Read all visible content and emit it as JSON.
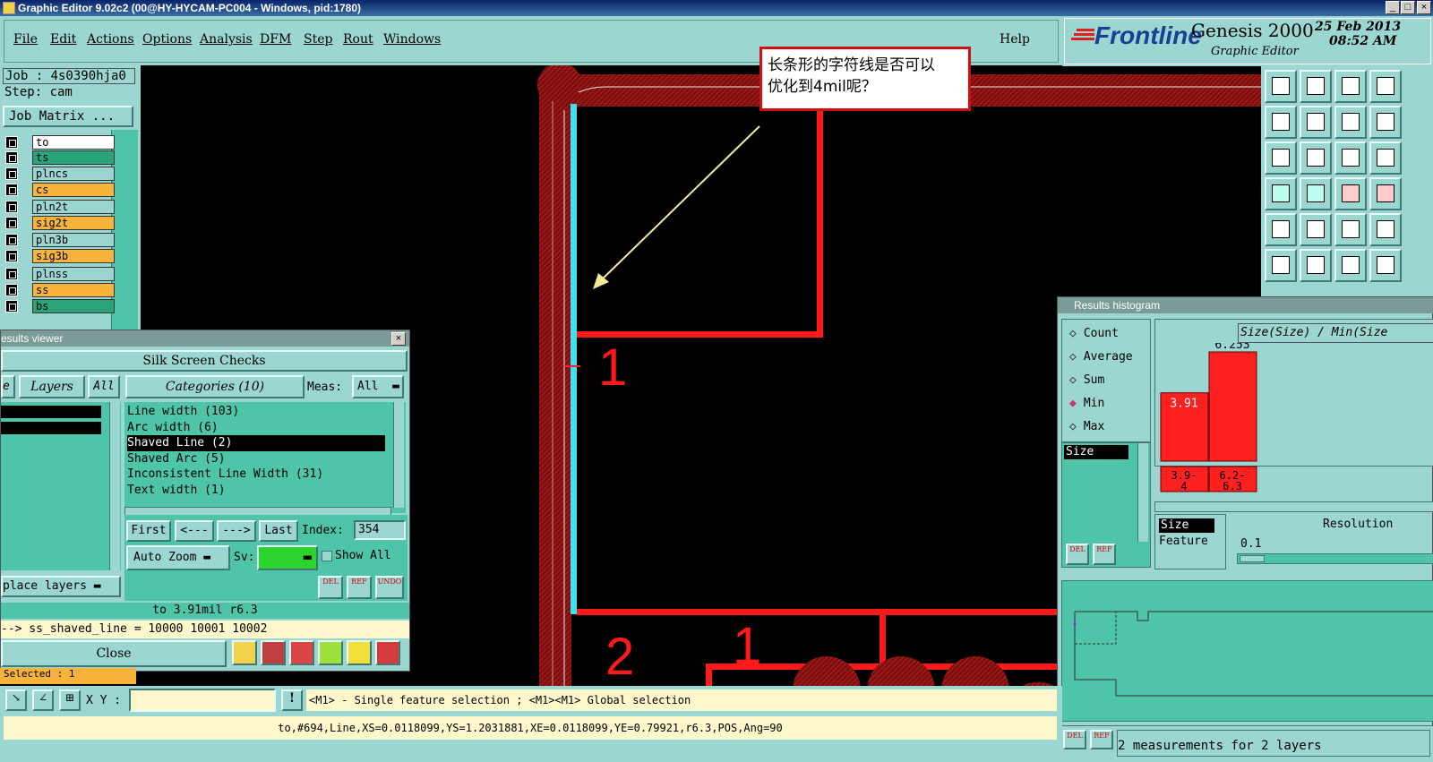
{
  "window": {
    "title": "Graphic Editor 9.02c2 (00@HY-HYCAM-PC004 - Windows, pid:1780)"
  },
  "menu": [
    "File",
    "Edit",
    "Actions",
    "Options",
    "Analysis",
    "DFM",
    "Step",
    "Rout",
    "Windows"
  ],
  "menu_help": "Help",
  "logo": {
    "brand": "Frontline",
    "product": "Genesis 2000",
    "subtitle": "Graphic Editor",
    "date": "25 Feb 2013",
    "time": "08:52 AM"
  },
  "job": {
    "job_label": "Job : 4s0390hja0",
    "step_label": "Step: cam",
    "matrix_button": "Job Matrix ..."
  },
  "layers": [
    {
      "name": "to",
      "color": "#ffffff"
    },
    {
      "name": "ts",
      "color": "#2aa57a"
    },
    {
      "name": "plncs",
      "color": "#9bd6d1"
    },
    {
      "name": "cs",
      "color": "#f7b33c"
    },
    {
      "name": "pln2t",
      "color": "#9bd6d1"
    },
    {
      "name": "sig2t",
      "color": "#f7b33c"
    },
    {
      "name": "pln3b",
      "color": "#9bd6d1"
    },
    {
      "name": "sig3b",
      "color": "#f7b33c"
    },
    {
      "name": "plnss",
      "color": "#9bd6d1"
    },
    {
      "name": "ss",
      "color": "#f7b33c"
    },
    {
      "name": "bs",
      "color": "#2aa57a"
    }
  ],
  "callout": {
    "text_line1": "长条形的字符线是否可以",
    "text_line2": "优化到4mil呢？"
  },
  "canvas": {
    "label_1a": "1",
    "label_2": "2",
    "label_1b": "1"
  },
  "results_viewer": {
    "title": "esults viewer",
    "header": "Silk Screen Checks",
    "tab_e": "e",
    "tab_layers": "Layers",
    "tab_all": "All",
    "categories_button": "Categories (10)",
    "meas_label": "Meas:",
    "meas_value": "All",
    "categories": [
      "Line width (103)",
      "Arc width (6)",
      "Shaved Line (2)",
      "Shaved Arc (5)",
      "Inconsistent Line Width (31)",
      "Text width (1)"
    ],
    "selected_category": "Shaved Line (2)",
    "nav": {
      "first": "First",
      "prev": "<---",
      "next": "--->",
      "last": "Last",
      "index_label": "Index:",
      "index_value": "354"
    },
    "auto_zoom": "Auto Zoom",
    "sv_label": "Sv:",
    "show_all": "Show All",
    "replace_layers": "place layers",
    "small_btns": [
      "DEL",
      "REF",
      "UNDO"
    ],
    "result_line": "to  3.91mil  r6.3",
    "attr_line": "--> ss_shaved_line = 10000 10001 10002",
    "close": "Close",
    "selected": "Selected : 1"
  },
  "histogram": {
    "title": "Results histogram",
    "options": [
      "Count",
      "Average",
      "Sum",
      "Min",
      "Max"
    ],
    "selected": "Min",
    "plot_title": "Size(Size) / Min(Size",
    "list_item": "Size",
    "res_items": [
      "Size",
      "Feature"
    ],
    "resolution_label": "Resolution",
    "resolution_value": "0.1",
    "footer": "2 measurements for 2 layers",
    "small_btns": [
      "DEL",
      "REF"
    ]
  },
  "chart_data": {
    "type": "bar",
    "categories": [
      "3.9-4",
      "6.2-6.3"
    ],
    "values": [
      3.91,
      6.253
    ],
    "title": "Size(Size) / Min(Size",
    "value_labels": [
      "3.91",
      "6.253"
    ],
    "bar_color": "#ff2020"
  },
  "bottom": {
    "xy_label": "X Y :",
    "hint": "<M1> - Single feature selection ; <M1><M1> Global selection",
    "status": "to,#694,Line,XS=0.0118099,YS=1.2031881,XE=0.0118099,YE=0.79921,r6.3,POS,Ang=90"
  }
}
